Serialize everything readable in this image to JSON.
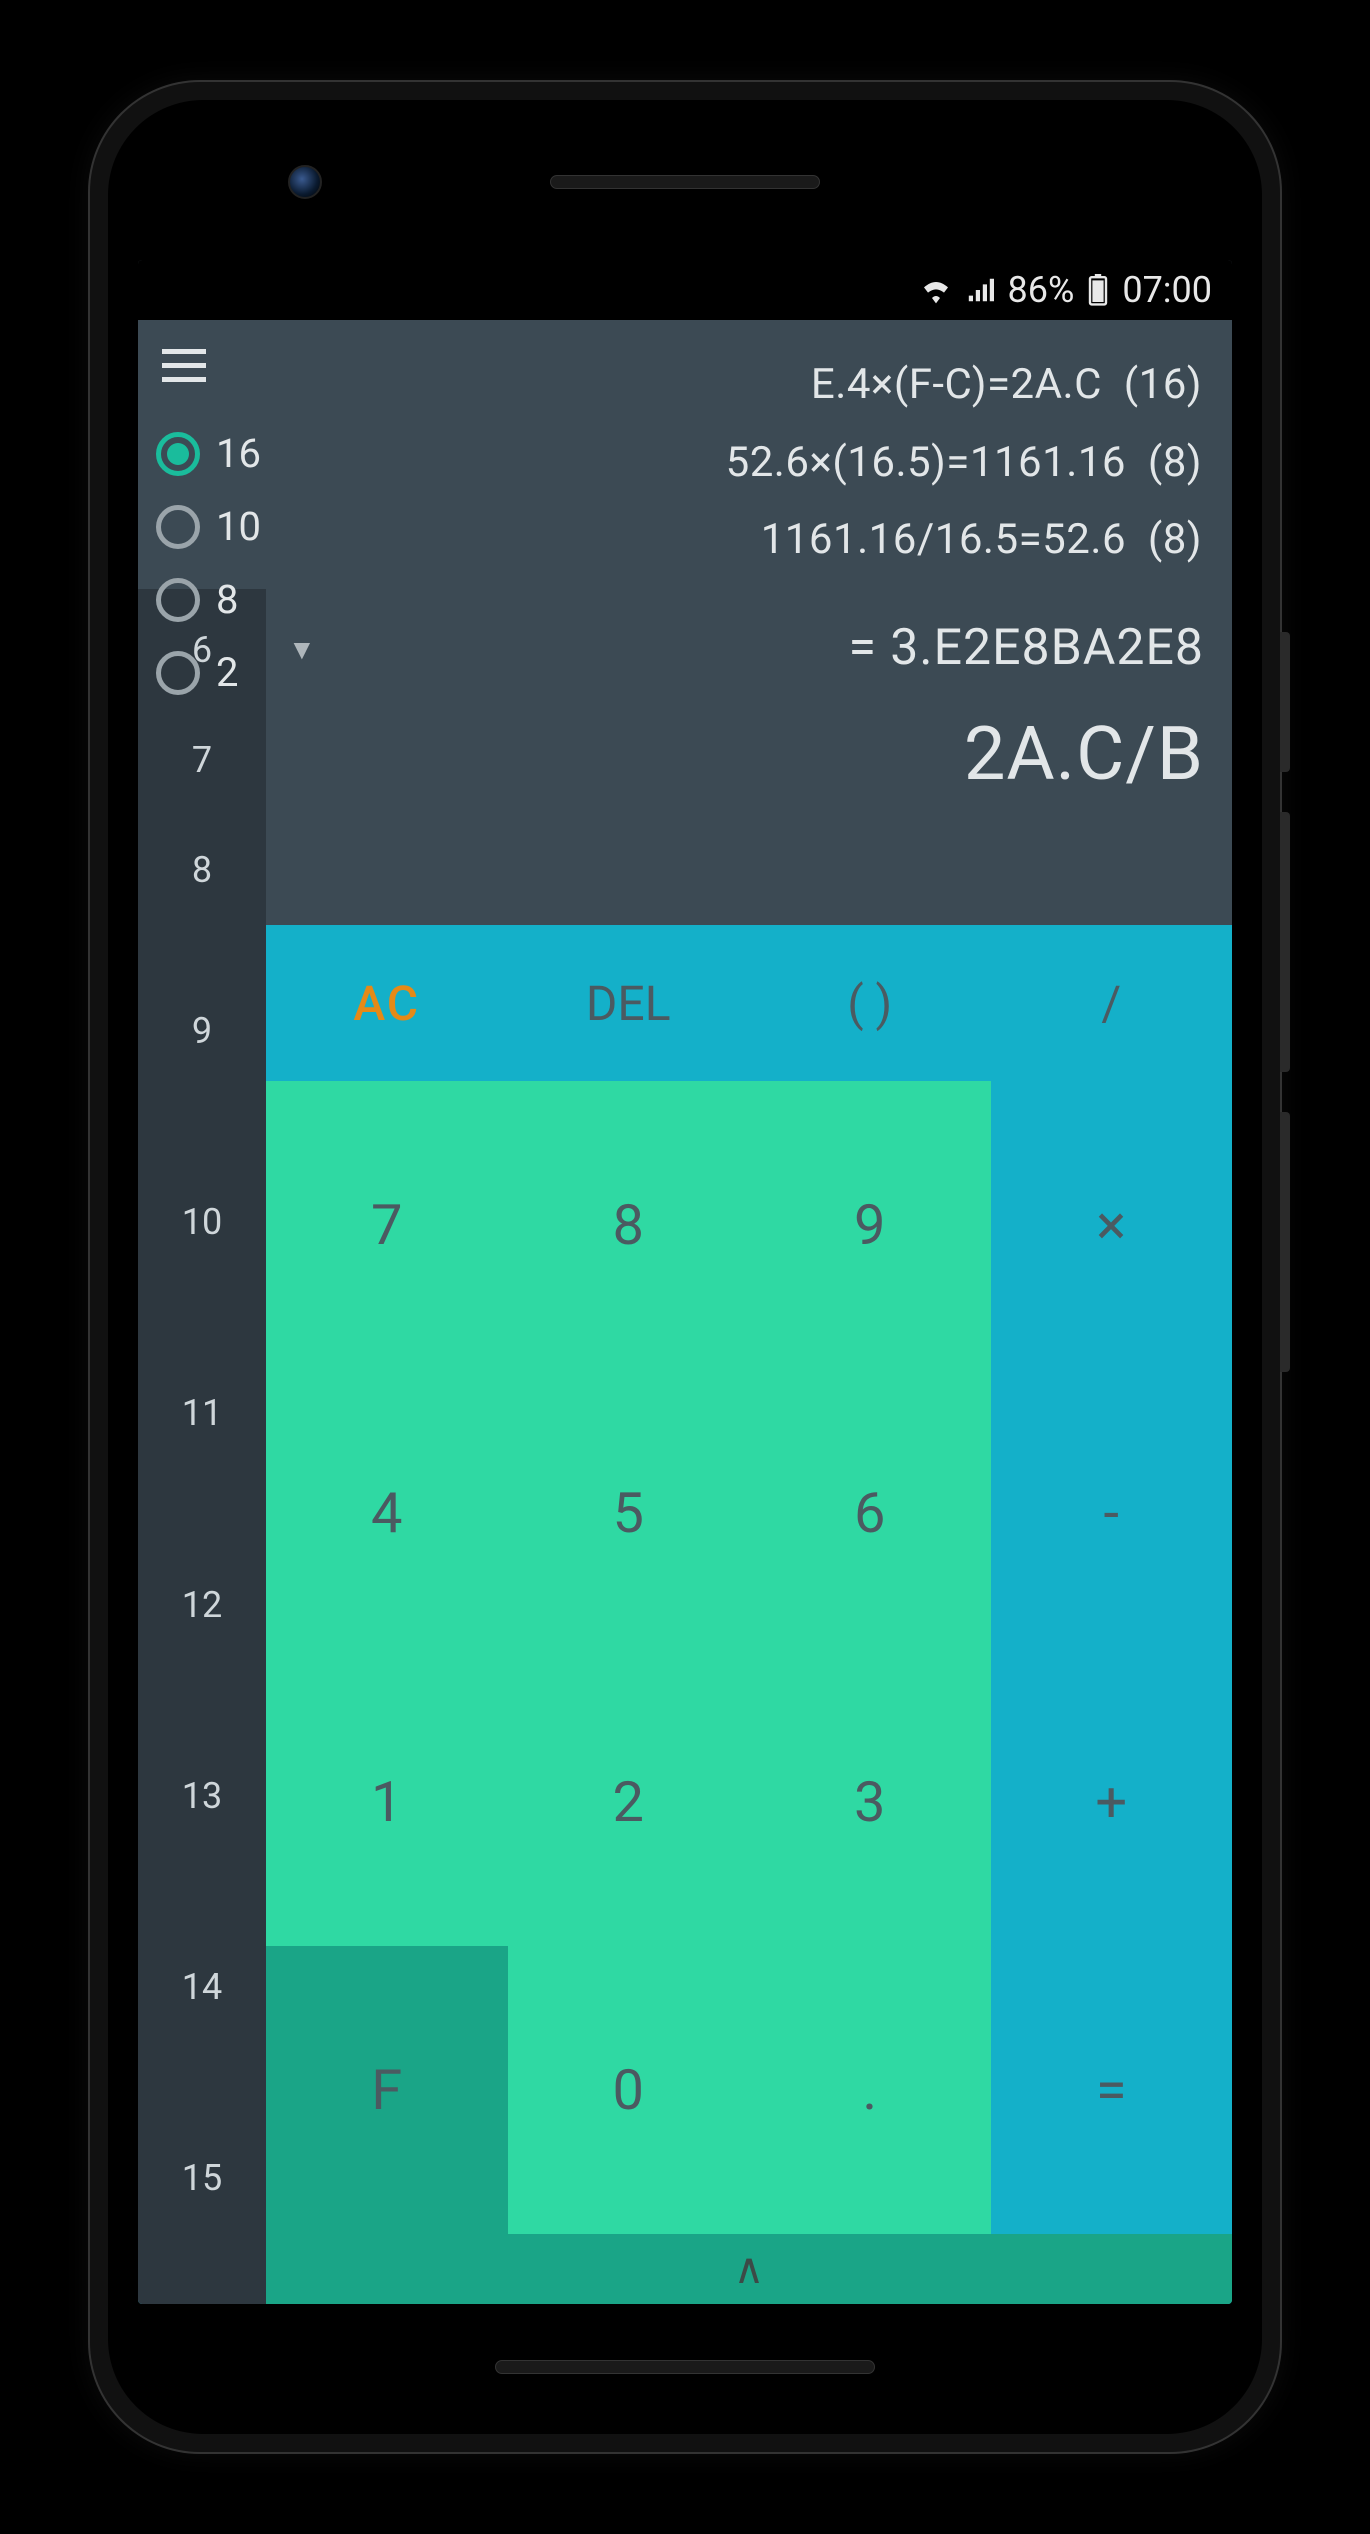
{
  "statusbar": {
    "battery_pct": "86%",
    "time": "07:00"
  },
  "history": [
    {
      "expr": "E.4×(F-C)=2A.C",
      "base": "(16)"
    },
    {
      "expr": "52.6×(16.5)=1161.16",
      "base": "(8)"
    },
    {
      "expr": "1161.16/16.5=52.6",
      "base": "(8)"
    }
  ],
  "radix_options": [
    "16",
    "10",
    "8",
    "2"
  ],
  "radix_selected": "16",
  "result_prefix": "= ",
  "result_value": "3.E2E8BA2E8",
  "input_expr": "2A.C/B",
  "precision_top": [
    "6",
    "7",
    "8"
  ],
  "precision_values": [
    "9",
    "10",
    "11",
    "12",
    "13",
    "14",
    "15"
  ],
  "keys": {
    "ac": "AC",
    "del": "DEL",
    "paren": "( )",
    "div": "/",
    "mul": "×",
    "sub": "-",
    "add": "+",
    "eq": "=",
    "k7": "7",
    "k8": "8",
    "k9": "9",
    "k4": "4",
    "k5": "5",
    "k6": "6",
    "k1": "1",
    "k2": "2",
    "k3": "3",
    "kF": "F",
    "k0": "0",
    "kdot": "."
  },
  "caret": "∧",
  "drop_caret": "▼"
}
